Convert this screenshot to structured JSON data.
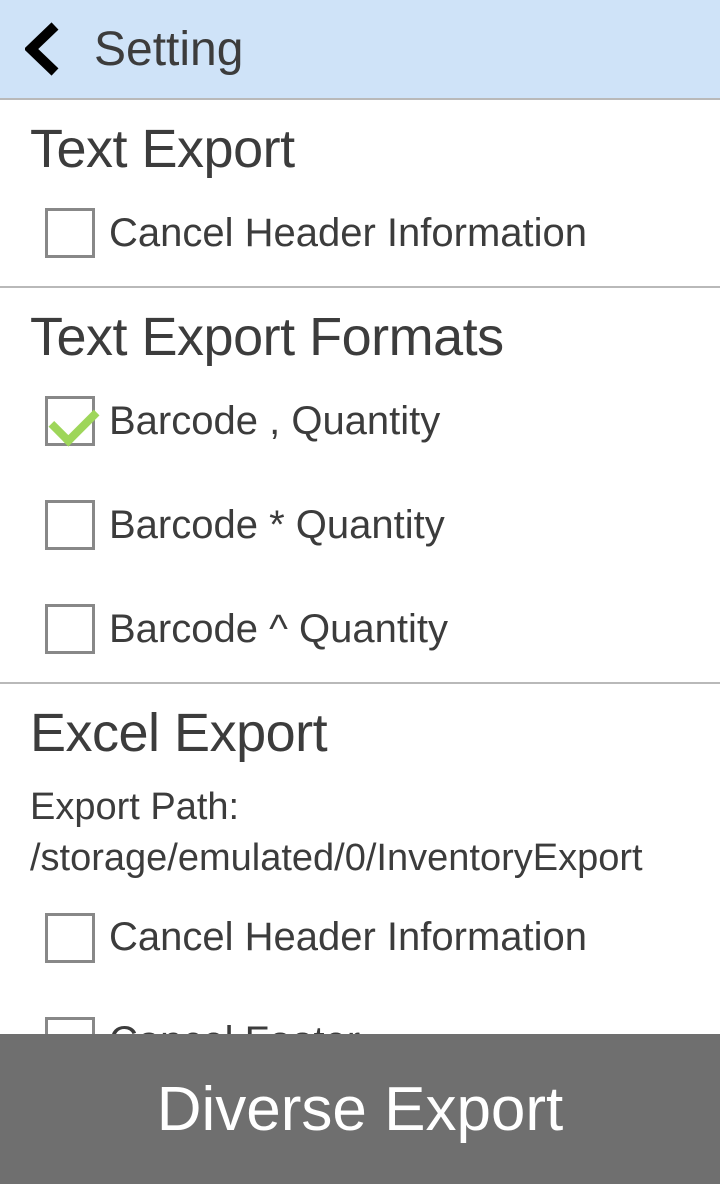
{
  "header": {
    "title": "Setting"
  },
  "text_export": {
    "title": "Text Export",
    "options": [
      {
        "label": "Cancel Header Information",
        "checked": false
      }
    ]
  },
  "text_export_formats": {
    "title": "Text Export Formats",
    "options": [
      {
        "label": "Barcode , Quantity",
        "checked": true
      },
      {
        "label": "Barcode * Quantity",
        "checked": false
      },
      {
        "label": "Barcode ^ Quantity",
        "checked": false
      }
    ]
  },
  "excel_export": {
    "title": "Excel Export",
    "path_text": "Export Path: /storage/emulated/0/InventoryExport",
    "options": [
      {
        "label": "Cancel Header Information",
        "checked": false
      },
      {
        "label": "Cancel Footer",
        "checked": false
      }
    ]
  },
  "footer": {
    "label": "Diverse Export"
  }
}
